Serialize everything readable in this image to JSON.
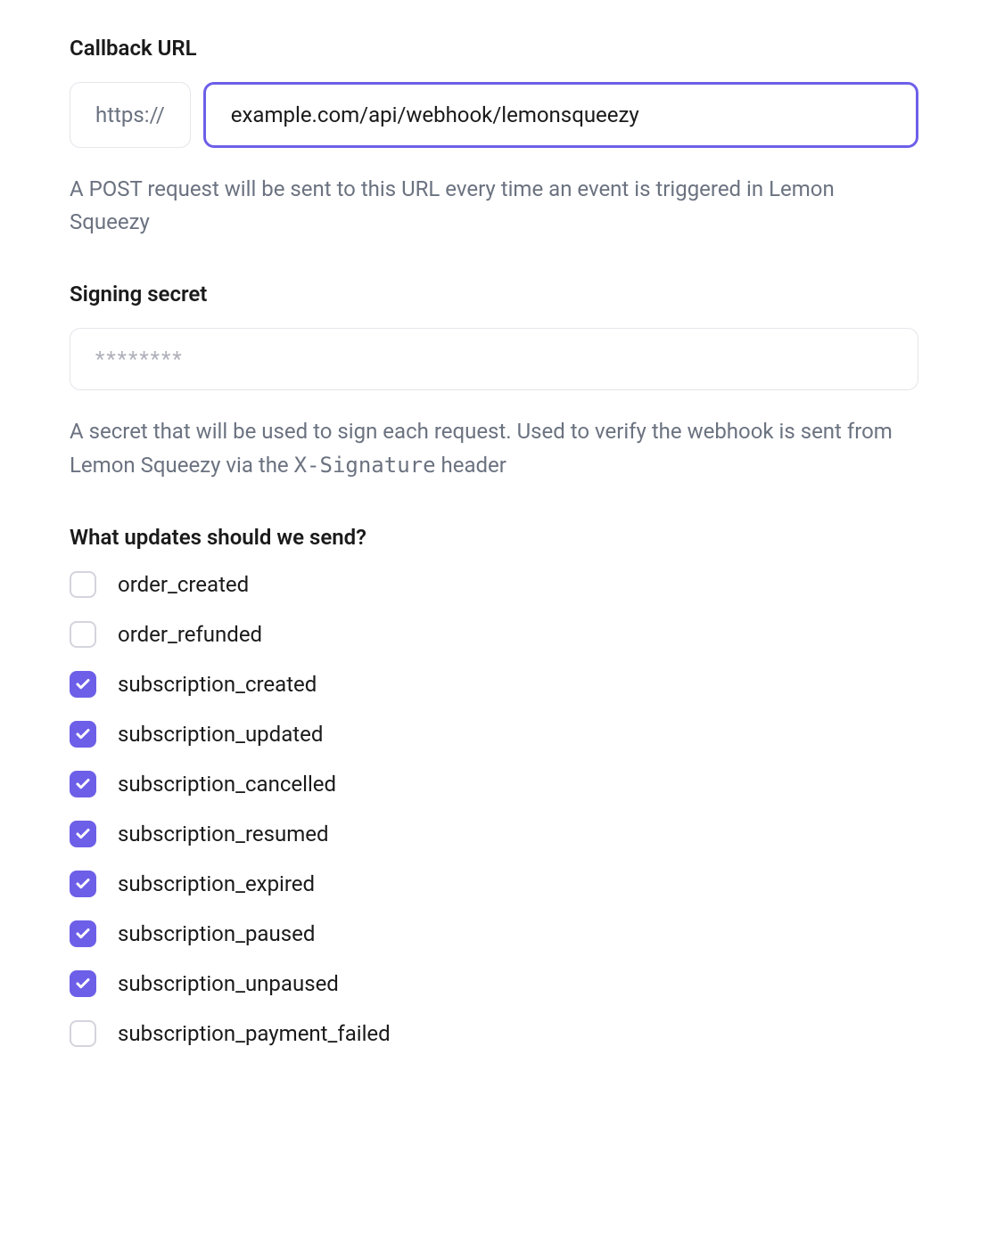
{
  "callback_url": {
    "label": "Callback URL",
    "prefix": "https://",
    "value": "example.com/api/webhook/lemonsqueezy",
    "help_text": "A POST request will be sent to this URL every time an event is triggered in Lemon Squeezy"
  },
  "signing_secret": {
    "label": "Signing secret",
    "placeholder": "********",
    "value": "",
    "help_text_pre": "A secret that will be used to sign each request. Used to verify the webhook is sent from Lemon Squeezy via the ",
    "help_text_code": "X-Signature",
    "help_text_post": " header"
  },
  "events": {
    "label": "What updates should we send?",
    "items": [
      {
        "name": "order_created",
        "checked": false
      },
      {
        "name": "order_refunded",
        "checked": false
      },
      {
        "name": "subscription_created",
        "checked": true
      },
      {
        "name": "subscription_updated",
        "checked": true
      },
      {
        "name": "subscription_cancelled",
        "checked": true
      },
      {
        "name": "subscription_resumed",
        "checked": true
      },
      {
        "name": "subscription_expired",
        "checked": true
      },
      {
        "name": "subscription_paused",
        "checked": true
      },
      {
        "name": "subscription_unpaused",
        "checked": true
      },
      {
        "name": "subscription_payment_failed",
        "checked": false
      }
    ]
  }
}
